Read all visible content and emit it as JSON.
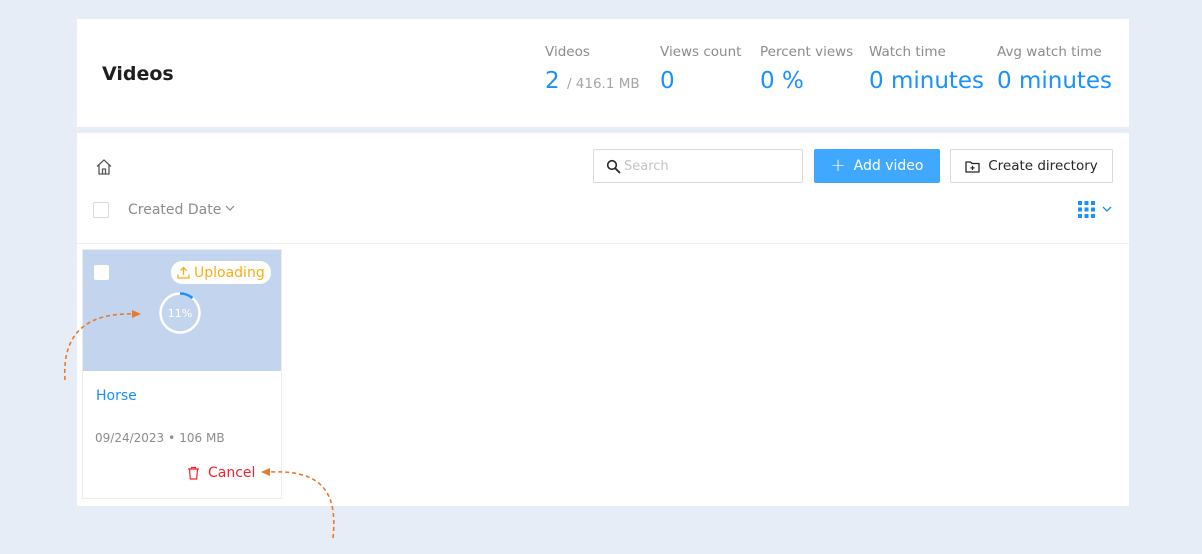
{
  "header": {
    "title": "Videos",
    "stats": [
      {
        "label": "Videos",
        "value": "2",
        "sub": "/ 416.1 MB"
      },
      {
        "label": "Views count",
        "value": "0"
      },
      {
        "label": "Percent views",
        "value": "0 %"
      },
      {
        "label": "Watch time",
        "value": "0 minutes"
      },
      {
        "label": "Avg watch time",
        "value": "0 minutes"
      }
    ]
  },
  "toolbar": {
    "search_placeholder": "Search",
    "add_label": "Add video",
    "dir_label": "Create directory",
    "sort_label": "Created Date"
  },
  "video": {
    "status": "Uploading",
    "progress": 11,
    "progress_label": "11%",
    "title": "Horse",
    "date": "09/24/2023",
    "size": "106 MB",
    "cancel_label": "Cancel"
  },
  "colors": {
    "accent": "#1890ff",
    "uploading": "#faad14",
    "danger": "#f5222d",
    "annotation": "#e8792d",
    "thumbnail": "#c2d4ee"
  }
}
